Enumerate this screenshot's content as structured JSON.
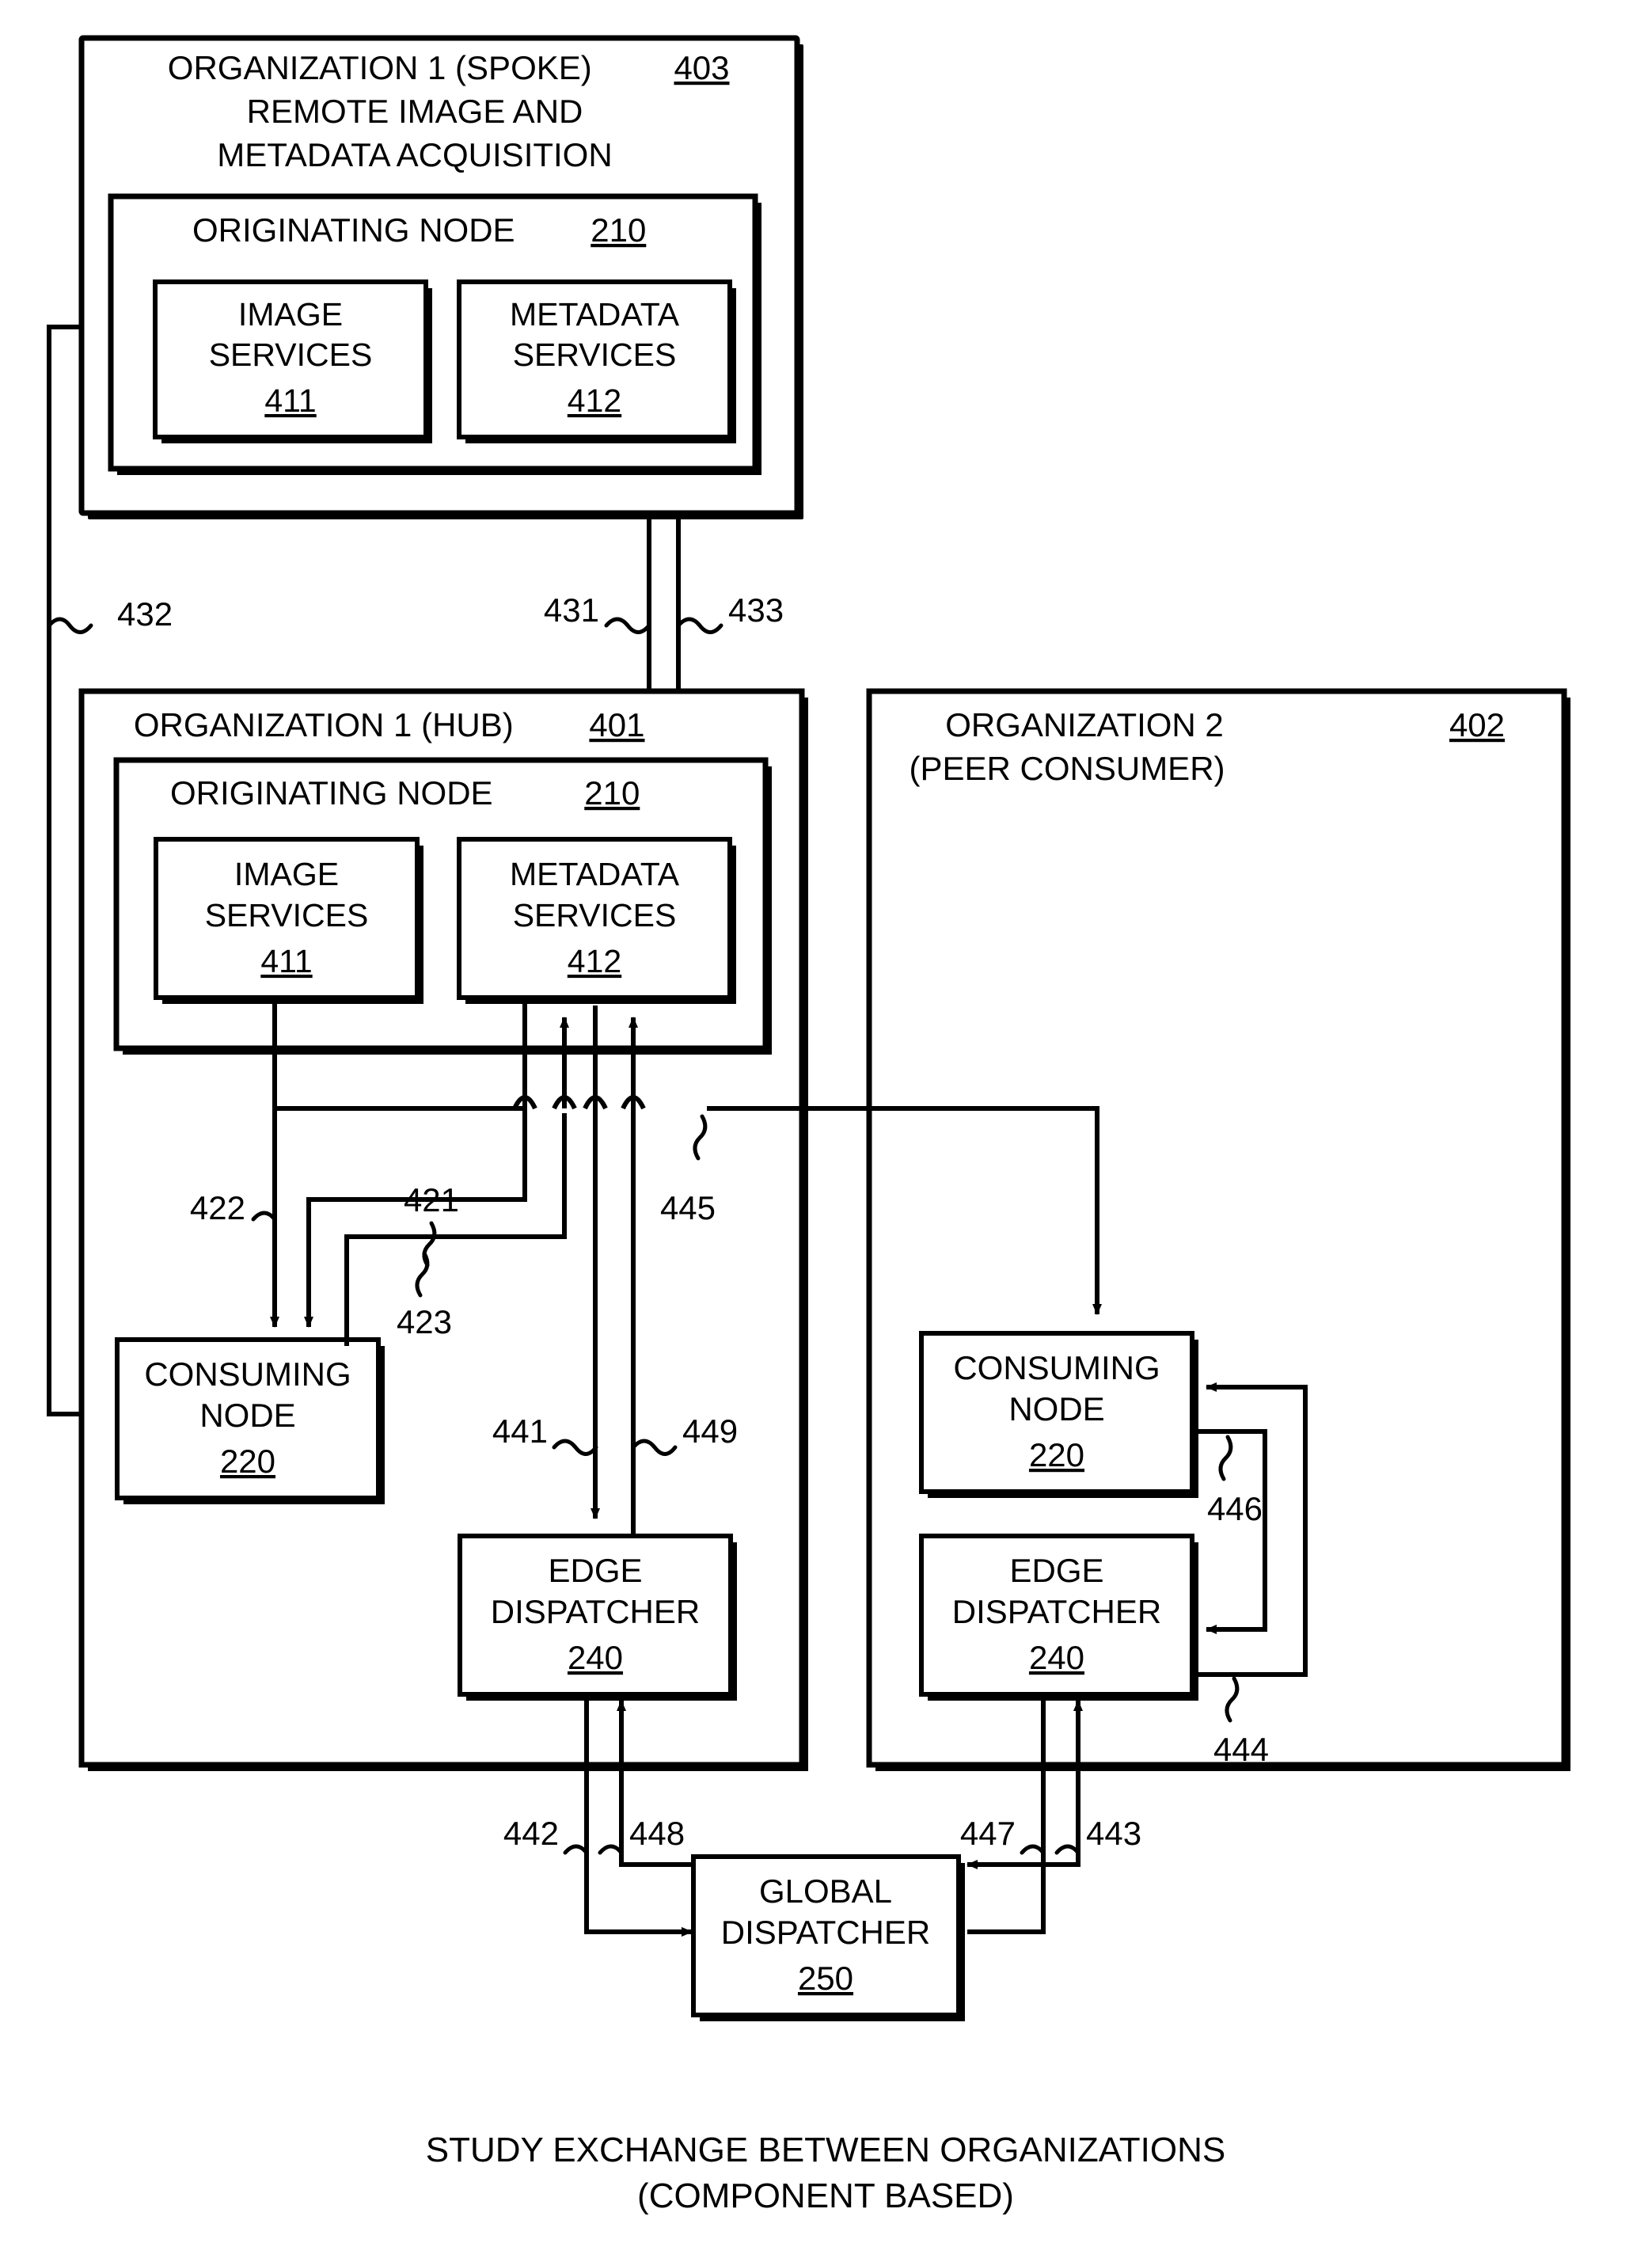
{
  "figure": {
    "caption_line1": "STUDY EXCHANGE BETWEEN ORGANIZATIONS",
    "caption_line2": "(COMPONENT BASED)"
  },
  "spoke": {
    "title_line1": "ORGANIZATION 1 (SPOKE)",
    "title_ref": "403",
    "title_line2": "REMOTE IMAGE AND",
    "title_line3": "METADATA ACQUISITION",
    "originating_node": {
      "label": "ORIGINATING NODE",
      "ref": "210",
      "image_services": {
        "line1": "IMAGE",
        "line2": "SERVICES",
        "ref": "411"
      },
      "metadata_services": {
        "line1": "METADATA",
        "line2": "SERVICES",
        "ref": "412"
      }
    }
  },
  "hub": {
    "title": "ORGANIZATION 1 (HUB)",
    "title_ref": "401",
    "originating_node": {
      "label": "ORIGINATING NODE",
      "ref": "210",
      "image_services": {
        "line1": "IMAGE",
        "line2": "SERVICES",
        "ref": "411"
      },
      "metadata_services": {
        "line1": "METADATA",
        "line2": "SERVICES",
        "ref": "412"
      }
    },
    "consuming_node": {
      "line1": "CONSUMING",
      "line2": "NODE",
      "ref": "220"
    },
    "edge_dispatcher": {
      "line1": "EDGE",
      "line2": "DISPATCHER",
      "ref": "240"
    }
  },
  "peer": {
    "title_line1": "ORGANIZATION 2",
    "title_line2": "(PEER CONSUMER)",
    "title_ref": "402",
    "consuming_node": {
      "line1": "CONSUMING",
      "line2": "NODE",
      "ref": "220"
    },
    "edge_dispatcher": {
      "line1": "EDGE",
      "line2": "DISPATCHER",
      "ref": "240"
    }
  },
  "global_dispatcher": {
    "line1": "GLOBAL",
    "line2": "DISPATCHER",
    "ref": "250"
  },
  "connector_refs": {
    "r431": "431",
    "r432": "432",
    "r433": "433",
    "r421": "421",
    "r422": "422",
    "r423": "423",
    "r441": "441",
    "r442": "442",
    "r443": "443",
    "r444": "444",
    "r445": "445",
    "r446": "446",
    "r447": "447",
    "r448": "448",
    "r449": "449"
  }
}
